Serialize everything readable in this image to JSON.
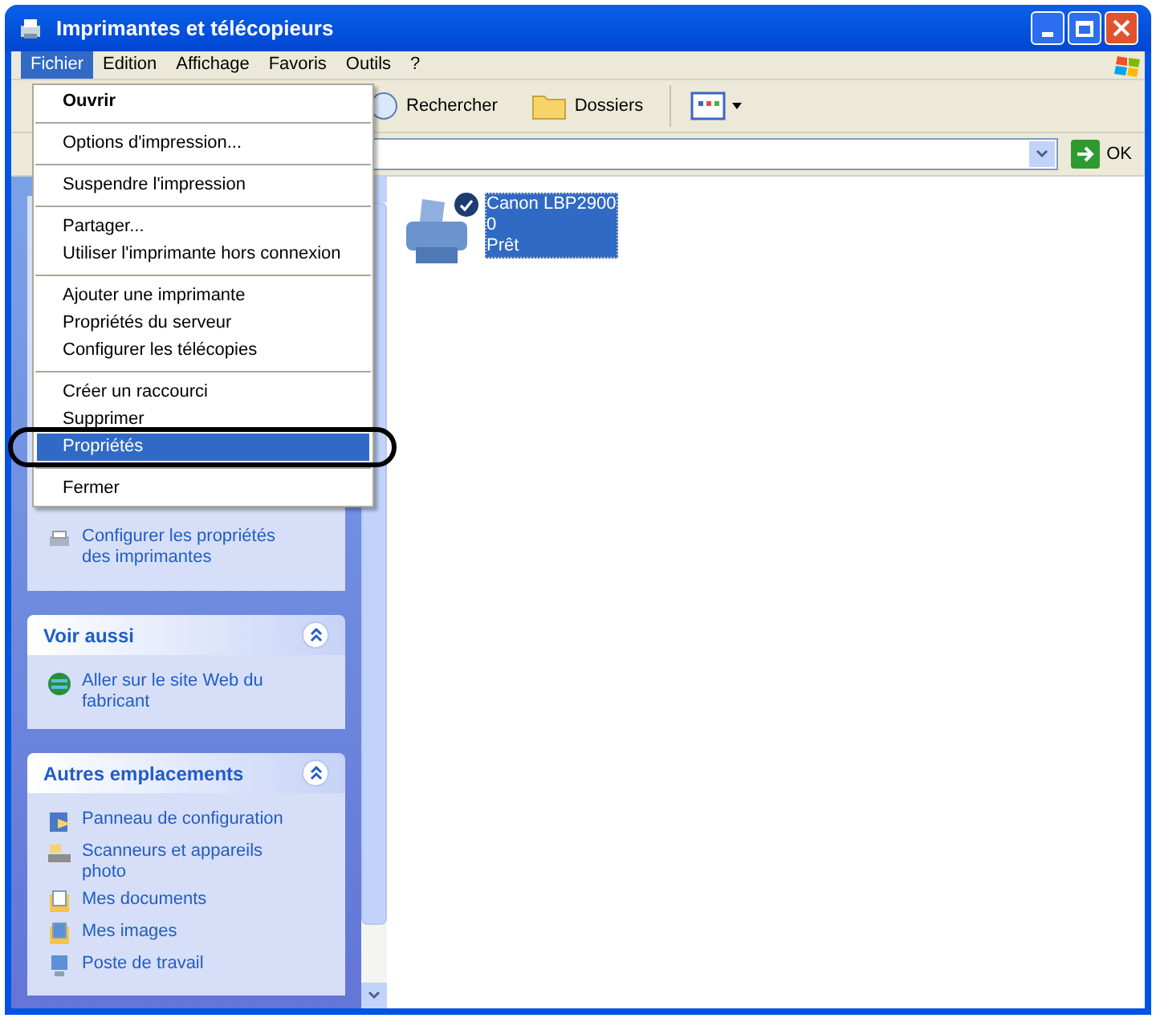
{
  "window": {
    "title": "Imprimantes et télécopieurs"
  },
  "menu_bar": [
    {
      "label": "Fichier",
      "selected": true
    },
    {
      "label": "Edition",
      "selected": false
    },
    {
      "label": "Affichage",
      "selected": false
    },
    {
      "label": "Favoris",
      "selected": false
    },
    {
      "label": "Outils",
      "selected": false
    },
    {
      "label": "?",
      "selected": false
    }
  ],
  "toolbar": [
    {
      "kind": "search",
      "label": "Rechercher"
    },
    {
      "kind": "folders",
      "label": "Dossiers"
    },
    {
      "kind": "views"
    }
  ],
  "address_bar": {
    "go_button": "OK"
  },
  "sidebar": {
    "sections": [
      {
        "items": [
          {
            "kind": "printer-settings",
            "label": "Configurer les propriétés des imprimantes"
          }
        ]
      },
      {
        "title": "Voir aussi",
        "expanded": true,
        "items": [
          {
            "kind": "web",
            "label": "Aller sur le site Web du fabricant"
          }
        ]
      },
      {
        "title": "Autres emplacements",
        "expanded": true,
        "items": [
          {
            "kind": "control-panel",
            "label": "Panneau de configuration"
          },
          {
            "kind": "scanner",
            "label": "Scanneurs et appareils photo"
          },
          {
            "kind": "documents",
            "label": "Mes documents"
          },
          {
            "kind": "pictures",
            "label": "Mes images"
          },
          {
            "kind": "computer",
            "label": "Poste de travail"
          }
        ]
      }
    ]
  },
  "printers": [
    {
      "name": "Canon LBP2900",
      "jobs": "0",
      "status": "Prêt",
      "default": true,
      "selected": true
    }
  ],
  "file_menu": {
    "groups": [
      [
        {
          "label": "Ouvrir",
          "default": true,
          "selected": false,
          "circled": false
        }
      ],
      [
        {
          "label": "Options d'impression...",
          "default": false,
          "selected": false,
          "circled": false
        }
      ],
      [
        {
          "label": "Suspendre l'impression",
          "default": false,
          "selected": false,
          "circled": false
        }
      ],
      [
        {
          "label": "Partager...",
          "default": false,
          "selected": false,
          "circled": false
        },
        {
          "label": "Utiliser l'imprimante hors connexion",
          "default": false,
          "selected": false,
          "circled": false
        }
      ],
      [
        {
          "label": "Ajouter une imprimante",
          "default": false,
          "selected": false,
          "circled": false
        },
        {
          "label": "Propriétés du serveur",
          "default": false,
          "selected": false,
          "circled": false
        },
        {
          "label": "Configurer les télécopies",
          "default": false,
          "selected": false,
          "circled": false
        }
      ],
      [
        {
          "label": "Créer un raccourci",
          "default": false,
          "selected": false,
          "circled": false
        },
        {
          "label": "Supprimer",
          "default": false,
          "selected": false,
          "circled": false
        },
        {
          "label": "Propriétés",
          "default": false,
          "selected": true,
          "circled": true
        }
      ],
      [
        {
          "label": "Fermer",
          "default": false,
          "selected": false,
          "circled": false
        }
      ]
    ]
  }
}
